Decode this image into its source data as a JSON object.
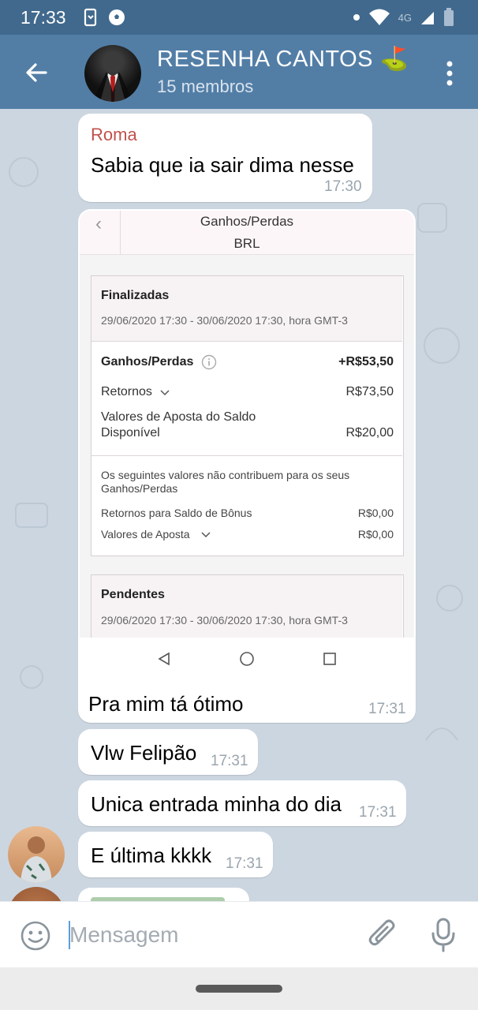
{
  "status": {
    "time": "17:33",
    "network": "4G"
  },
  "header": {
    "title": "RESENHA CANTOS ⛳",
    "subtitle": "15 membros"
  },
  "messages": [
    {
      "sender": "Roma",
      "text": "Sabia que ia sair dima nesse",
      "time": "17:30"
    },
    {
      "text": "Pra mim tá ótimo",
      "time": "17:31"
    },
    {
      "text": "Vlw Felipão",
      "time": "17:31"
    },
    {
      "text": "Unica entrada minha do dia",
      "time": "17:31"
    },
    {
      "text": "E última kkkk",
      "time": "17:31"
    }
  ],
  "screenshot": {
    "title": "Ganhos/Perdas",
    "currency": "BRL",
    "finalizadas": {
      "heading": "Finalizadas",
      "period": "29/06/2020 17:30 - 30/06/2020 17:30, hora GMT-3",
      "ganhos_label": "Ganhos/Perdas",
      "ganhos_value": "+R$53,50",
      "retornos_label": "Retornos",
      "retornos_value": "R$73,50",
      "aposta_label_1": "Valores de Aposta do Saldo",
      "aposta_label_2": "Disponível",
      "aposta_value": "R$20,00",
      "note_1": "Os seguintes valores não contribuem para os seus",
      "note_2": "Ganhos/Perdas",
      "bonus_label": "Retornos para Saldo de Bônus",
      "bonus_value": "R$0,00",
      "valores_label": "Valores de Aposta",
      "valores_value": "R$0,00"
    },
    "pendentes": {
      "heading": "Pendentes",
      "period": "29/06/2020 17:30 - 30/06/2020 17:30, hora GMT-3"
    }
  },
  "input": {
    "placeholder": "Mensagem"
  },
  "colors": {
    "header": "#527ea6",
    "statusbar": "#41698d",
    "chat_bg": "#ccd6e0",
    "sender": "#c0524c"
  }
}
